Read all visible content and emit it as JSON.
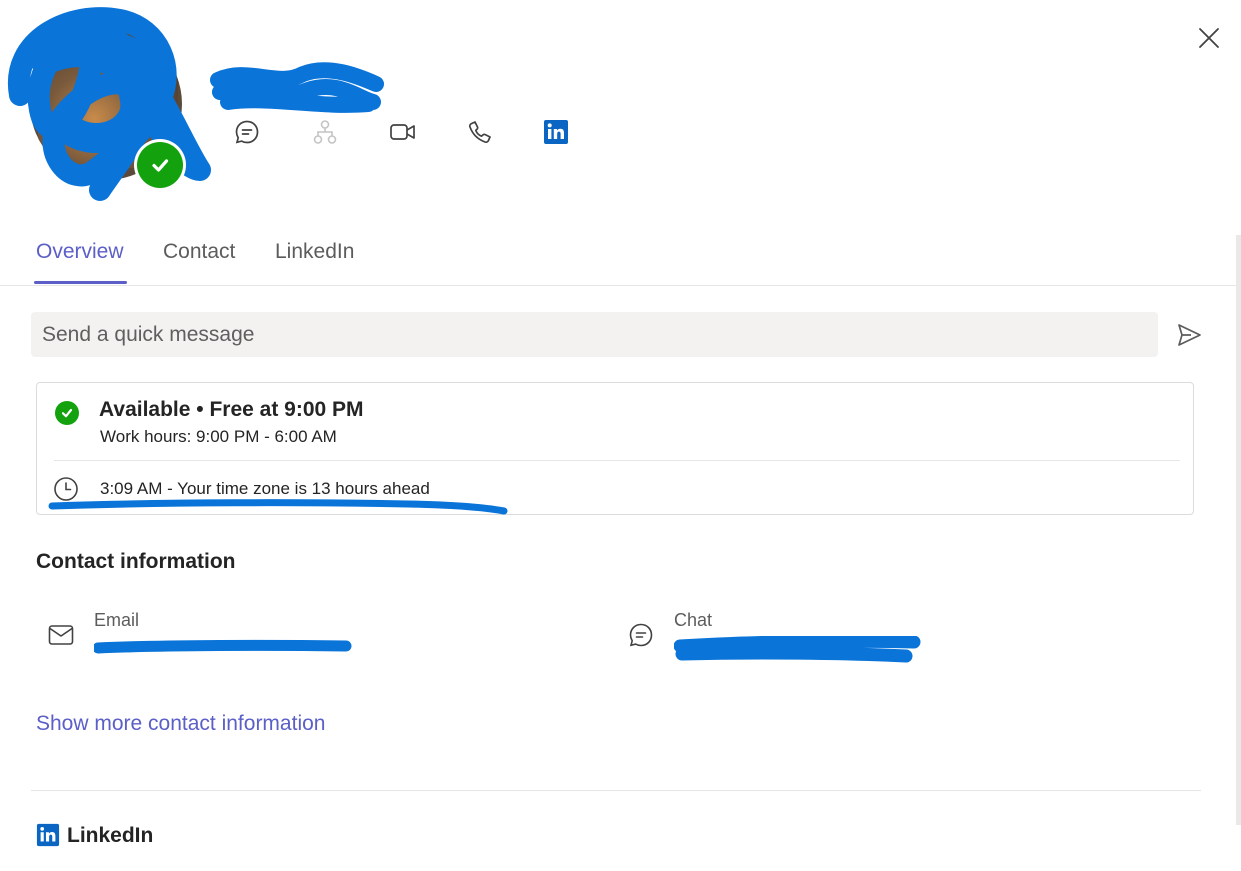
{
  "tabs": [
    {
      "label": "Overview"
    },
    {
      "label": "Contact"
    },
    {
      "label": "LinkedIn"
    }
  ],
  "quick_message": {
    "placeholder": "Send a quick message"
  },
  "availability": {
    "status": "Available • Free at 9:00 PM",
    "work_hours": "Work hours: 9:00 PM - 6:00 AM",
    "local_time": "3:09 AM - Your time zone is 13 hours ahead"
  },
  "contact": {
    "heading": "Contact information",
    "email_label": "Email",
    "chat_label": "Chat",
    "show_more": "Show more contact information"
  },
  "linkedin_section": {
    "heading": "LinkedIn"
  },
  "icons": {
    "actions": [
      "chat-icon",
      "org-chart-icon",
      "video-call-icon",
      "phone-icon",
      "linkedin-icon"
    ],
    "close": "close-icon",
    "send": "send-icon",
    "presence": "available-check-icon"
  },
  "colors": {
    "accent": "#5b5fc7",
    "available": "#13a10e",
    "linkedin": "#0a66c2",
    "redaction": "#0a74d8"
  }
}
